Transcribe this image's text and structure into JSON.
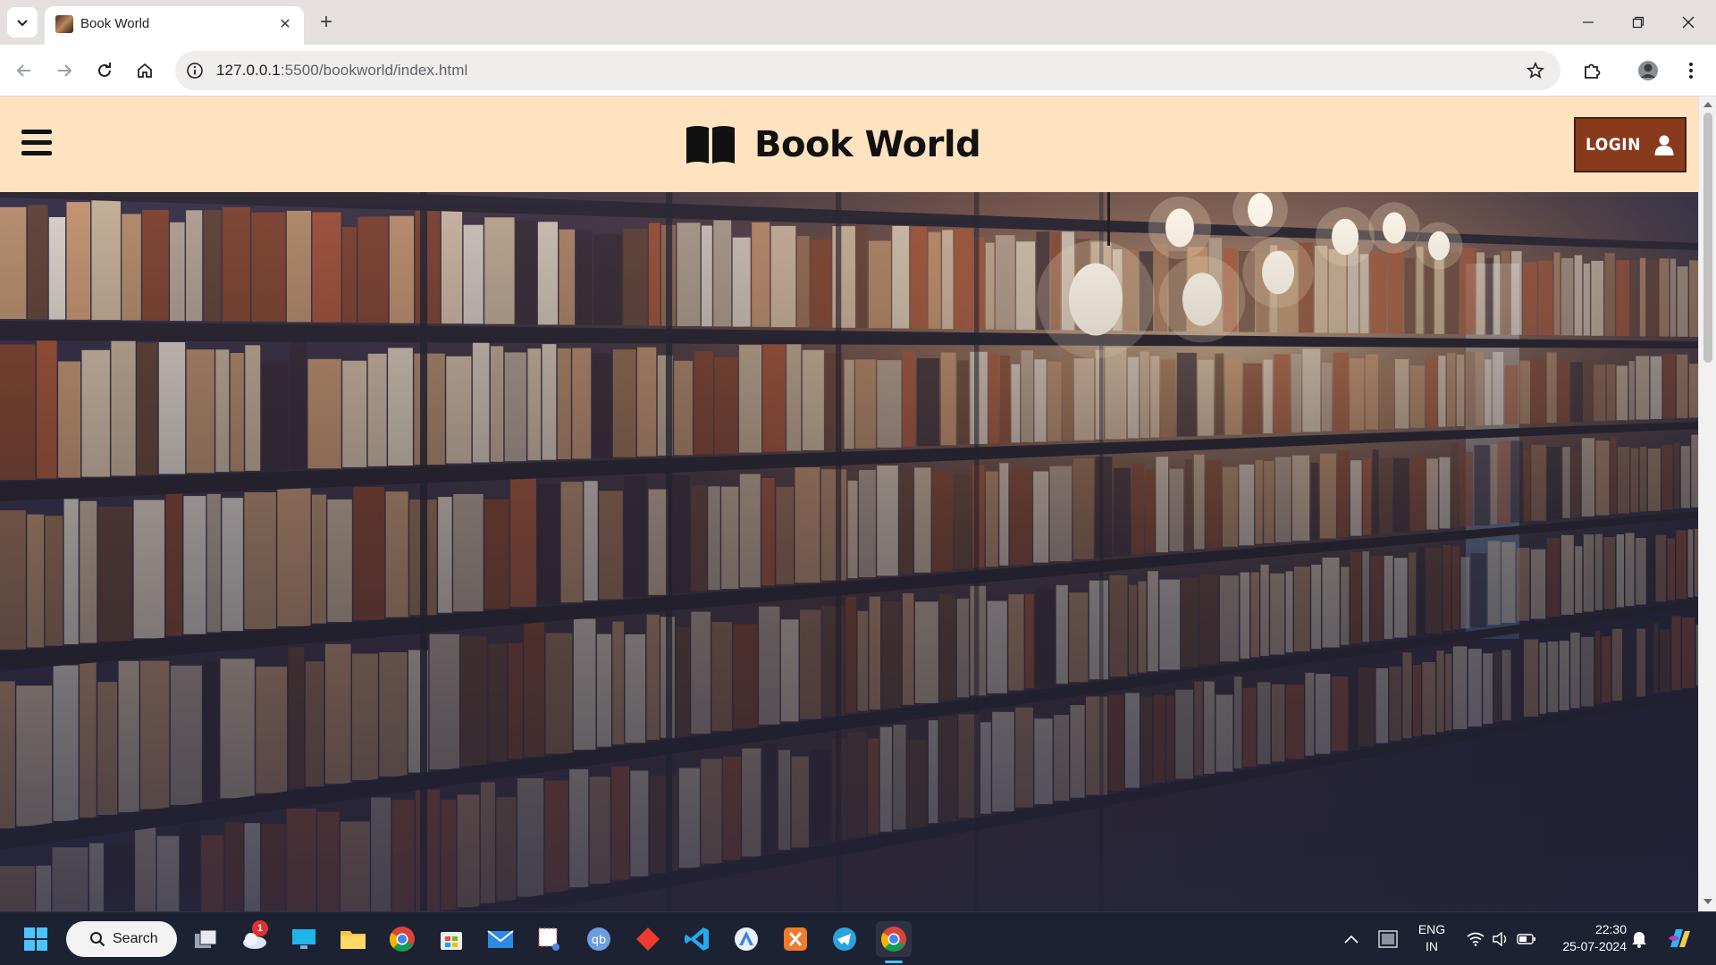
{
  "browser": {
    "tab_title": "Book World",
    "url_host": "127.0.0.1",
    "url_path": ":5500/bookworld/index.html"
  },
  "site": {
    "brand": "Book World",
    "login_label": "LOGIN"
  },
  "taskbar": {
    "search_label": "Search",
    "notification_count": "1",
    "lang_line1": "ENG",
    "lang_line2": "IN",
    "time": "22:30",
    "date": "25-07-2024"
  },
  "icons": {
    "logo": "open-book-icon",
    "login": "user-icon",
    "menu": "hamburger-icon"
  },
  "colors": {
    "header_bg": "#ffe3c0",
    "login_bg": "#8a3a1c",
    "taskbar_bg": "#1d2232"
  }
}
